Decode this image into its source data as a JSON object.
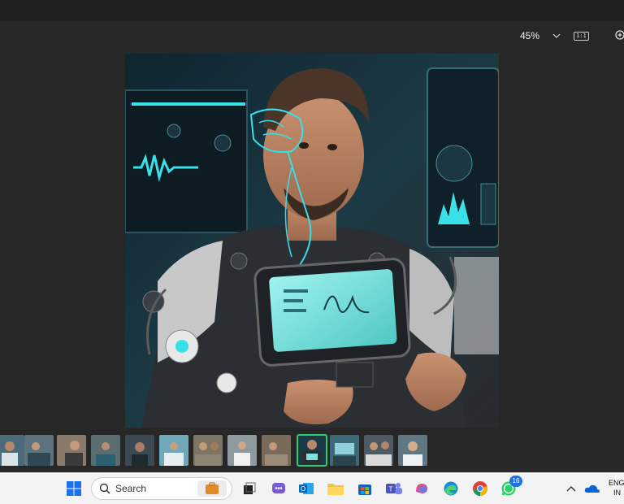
{
  "toolbar": {
    "zoom_value": "45%",
    "actual_size_icon": "1:1"
  },
  "main_image": {
    "icon": "cyborg-medical-portrait",
    "description": "man with wearable tablet and sensors"
  },
  "filmstrip": {
    "thumbnail_count": 12,
    "selected_index": 9
  },
  "taskbar": {
    "search_placeholder": "Search",
    "whatsapp_badge": "16",
    "language_line1": "ENG",
    "language_line2": "IN"
  },
  "colors": {
    "accent_cyan": "#38e0e8",
    "selected_thumb": "#2ecc71",
    "taskbar_bg": "#f3f3f3",
    "viewer_bg": "#272727"
  }
}
